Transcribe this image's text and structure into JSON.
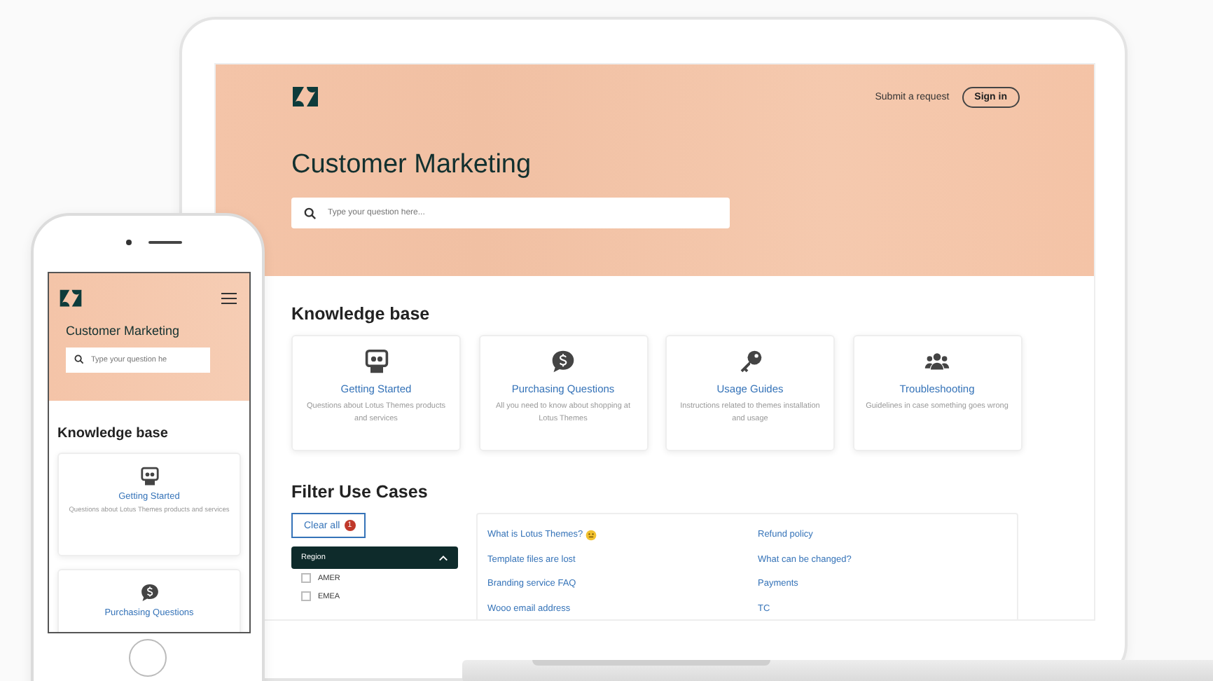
{
  "desktop": {
    "header": {
      "submit_link": "Submit a request",
      "sign_in": "Sign in"
    },
    "hero": {
      "title": "Customer Marketing",
      "search": {
        "placeholder": "Type your question here..."
      }
    },
    "knowledge_base": {
      "title": "Knowledge base",
      "categories": [
        {
          "kind": "getting-started",
          "title": "Getting Started",
          "description": "Questions about Lotus Themes products and services"
        },
        {
          "kind": "purchasing",
          "title": "Purchasing Questions",
          "description": "All you need to know about shopping at Lotus Themes"
        },
        {
          "kind": "usage",
          "title": "Usage Guides",
          "description": "Instructions related to themes installation and usage"
        },
        {
          "kind": "troubleshooting",
          "title": "Troubleshooting",
          "description": "Guidelines in case something goes wrong"
        }
      ]
    },
    "filter": {
      "title": "Filter Use Cases",
      "clear_all": {
        "label": "Clear all",
        "count": "1"
      },
      "region": {
        "label": "Region",
        "expanded": true,
        "options": [
          {
            "label": "AMER",
            "checked": false
          },
          {
            "label": "EMEA",
            "checked": false
          }
        ]
      },
      "articles": [
        {
          "title": "What is Lotus Themes?",
          "emoji": true
        },
        {
          "title": "Refund policy",
          "emoji": false
        },
        {
          "title": "Template files are lost",
          "emoji": false
        },
        {
          "title": "What can be changed?",
          "emoji": false
        },
        {
          "title": "Branding service FAQ",
          "emoji": false
        },
        {
          "title": "Payments",
          "emoji": false
        },
        {
          "title": "Wooo email address",
          "emoji": false
        },
        {
          "title": "TC",
          "emoji": false
        }
      ]
    }
  },
  "mobile": {
    "hero": {
      "title": "Customer Marketing",
      "search": {
        "placeholder": "Type your question he"
      }
    },
    "knowledge_base": {
      "title": "Knowledge base",
      "categories": [
        {
          "kind": "getting-started",
          "title": "Getting Started",
          "description": "Questions about Lotus Themes products and services"
        },
        {
          "kind": "purchasing",
          "title": "Purchasing Questions"
        }
      ]
    }
  }
}
